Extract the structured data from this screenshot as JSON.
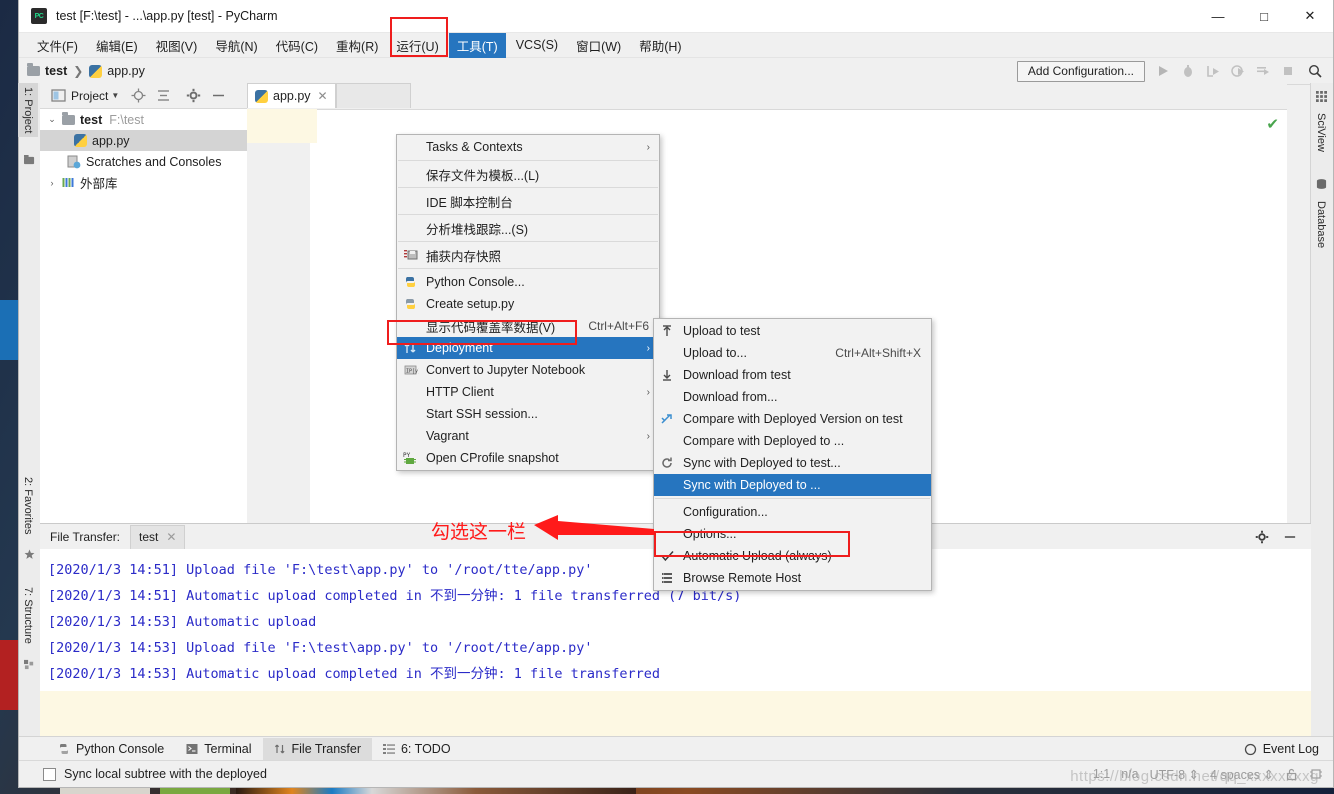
{
  "window": {
    "title": "test [F:\\test] - ...\\app.py [test] - PyCharm",
    "logo_text": "PC",
    "minimize": "—",
    "maximize": "□",
    "close": "✕"
  },
  "menubar": {
    "items": [
      {
        "label": "文件(F)",
        "active": false
      },
      {
        "label": "编辑(E)",
        "active": false
      },
      {
        "label": "视图(V)",
        "active": false
      },
      {
        "label": "导航(N)",
        "active": false
      },
      {
        "label": "代码(C)",
        "active": false
      },
      {
        "label": "重构(R)",
        "active": false
      },
      {
        "label": "运行(U)",
        "active": false
      },
      {
        "label": "工具(T)",
        "active": true
      },
      {
        "label": "VCS(S)",
        "active": false
      },
      {
        "label": "窗口(W)",
        "active": false
      },
      {
        "label": "帮助(H)",
        "active": false
      }
    ]
  },
  "navbar": {
    "crumb_project": "test",
    "crumb_sep": "❯",
    "crumb_file": "app.py",
    "add_configuration": "Add Configuration..."
  },
  "left_strip": {
    "project_label": "1: Project",
    "favorites_label": "2: Favorites",
    "structure_label": "7: Structure"
  },
  "right_strip": {
    "sciview_label": "SciView",
    "database_label": "Database"
  },
  "project_panel": {
    "header_label": "Project",
    "tree": [
      {
        "label": "test",
        "path": "F:\\test",
        "icon": "folder-icon",
        "twisty": "⌄",
        "selected": false,
        "indent": 0
      },
      {
        "label": "app.py",
        "path": "",
        "icon": "python-file-icon",
        "twisty": "",
        "selected": true,
        "indent": 1
      },
      {
        "label": "Scratches and Consoles",
        "path": "",
        "icon": "scratches-icon",
        "twisty": "",
        "selected": false,
        "indent": 1
      },
      {
        "label": "外部库",
        "path": "",
        "icon": "library-icon",
        "twisty": "›",
        "selected": false,
        "indent": 0
      }
    ]
  },
  "editor": {
    "tab_label": "app.py",
    "tab_close": "✕"
  },
  "tools_menu": {
    "items": [
      {
        "label": "Tasks & Contexts",
        "underline": "T",
        "icon": "",
        "arrow": "›",
        "accel": "",
        "check": false,
        "highlight": false,
        "sep_after": false
      },
      {
        "label": "保存文件为模板...(L)",
        "icon": "",
        "arrow": "",
        "accel": "",
        "check": false,
        "highlight": false,
        "sep_after": false
      },
      {
        "label": "IDE 脚本控制台",
        "icon": "",
        "arrow": "",
        "accel": "",
        "check": false,
        "highlight": false,
        "sep_after": false
      },
      {
        "label": "分析堆栈跟踪...(S)",
        "icon": "",
        "arrow": "",
        "accel": "",
        "check": false,
        "highlight": false,
        "sep_after": false
      },
      {
        "label": "捕获内存快照",
        "icon": "memory-snapshot-icon",
        "arrow": "",
        "accel": "",
        "check": false,
        "highlight": false,
        "sep_after": false
      },
      {
        "label": "Python Console...",
        "icon": "python-console-icon",
        "arrow": "",
        "accel": "",
        "check": false,
        "highlight": false,
        "sep_after": false
      },
      {
        "label": "Create setup.py",
        "icon": "python-setup-icon",
        "arrow": "",
        "accel": "",
        "check": false,
        "highlight": false,
        "sep_after": false
      },
      {
        "label": "显示代码覆盖率数据(V)",
        "icon": "",
        "arrow": "",
        "accel": "Ctrl+Alt+F6",
        "check": false,
        "highlight": false,
        "sep_after": false
      },
      {
        "label": "Deployment",
        "underline": "e",
        "icon": "deployment-icon",
        "arrow": "›",
        "accel": "",
        "check": false,
        "highlight": true,
        "sep_after": false
      },
      {
        "label": "Convert to Jupyter Notebook",
        "icon": "jupyter-icon",
        "arrow": "",
        "accel": "",
        "check": false,
        "highlight": false,
        "sep_after": false
      },
      {
        "label": "HTTP Client",
        "icon": "",
        "arrow": "›",
        "accel": "",
        "check": false,
        "highlight": false,
        "sep_after": false
      },
      {
        "label": "Start SSH session...",
        "icon": "",
        "arrow": "",
        "accel": "",
        "check": false,
        "highlight": false,
        "sep_after": false
      },
      {
        "label": "Vagrant",
        "icon": "",
        "arrow": "›",
        "accel": "",
        "check": false,
        "highlight": false,
        "sep_after": false
      },
      {
        "label": "Open CProfile snapshot",
        "icon": "cprofile-icon",
        "arrow": "",
        "accel": "",
        "check": false,
        "highlight": false,
        "sep_after": false
      }
    ]
  },
  "deployment_submenu": {
    "items": [
      {
        "label": "Upload to test",
        "icon": "upload-icon",
        "accel": "",
        "check": false,
        "highlight": false,
        "sep_after": false
      },
      {
        "label": "Upload to...",
        "icon": "",
        "accel": "Ctrl+Alt+Shift+X",
        "check": false,
        "highlight": false,
        "sep_after": false
      },
      {
        "label": "Download from test",
        "icon": "download-icon",
        "accel": "",
        "check": false,
        "highlight": false,
        "sep_after": false
      },
      {
        "label": "Download from...",
        "icon": "",
        "accel": "",
        "check": false,
        "highlight": false,
        "sep_after": false
      },
      {
        "label": "Compare with Deployed Version on test",
        "icon": "compare-icon",
        "accel": "",
        "check": false,
        "highlight": false,
        "sep_after": false
      },
      {
        "label": "Compare with Deployed to ...",
        "icon": "",
        "accel": "",
        "check": false,
        "highlight": false,
        "sep_after": false
      },
      {
        "label": "Sync with Deployed to test...",
        "icon": "sync-icon",
        "accel": "",
        "check": false,
        "highlight": false,
        "sep_after": false
      },
      {
        "label": "Sync with Deployed to ...",
        "icon": "",
        "accel": "",
        "check": false,
        "highlight": true,
        "sep_after": true
      },
      {
        "label": "Configuration...",
        "icon": "",
        "accel": "",
        "check": false,
        "highlight": false,
        "sep_after": false
      },
      {
        "label": "Options...",
        "icon": "",
        "accel": "",
        "check": false,
        "highlight": false,
        "sep_after": false
      },
      {
        "label": "Automatic Upload (always)",
        "icon": "",
        "accel": "",
        "check": true,
        "highlight": false,
        "sep_after": false
      },
      {
        "label": "Browse Remote Host",
        "icon": "browse-remote-icon",
        "accel": "",
        "check": false,
        "highlight": false,
        "sep_after": false
      }
    ]
  },
  "annotation": {
    "text": "勾选这一栏",
    "color": "#ff1a1a"
  },
  "file_transfer": {
    "panel_label": "File Transfer:",
    "tab_label": "test",
    "tab_close": "✕",
    "lines": [
      "[2020/1/3 14:51] Upload file 'F:\\test\\app.py' to '/root/tte/app.py'",
      "[2020/1/3 14:51] Automatic upload completed in 不到一分钟: 1 file transferred (7 bit/s)",
      "[2020/1/3 14:53] Automatic upload",
      "[2020/1/3 14:53] Upload file 'F:\\test\\app.py' to '/root/tte/app.py'",
      "[2020/1/3 14:53] Automatic upload completed in 不到一分钟: 1 file transferred"
    ]
  },
  "bottom_bar": {
    "tabs": [
      {
        "label": "Python Console",
        "icon": "python-console-icon",
        "active": false
      },
      {
        "label": "Terminal",
        "icon": "terminal-icon",
        "active": false
      },
      {
        "label": "File Transfer",
        "icon": "file-transfer-icon",
        "active": true
      },
      {
        "label": "6: TODO",
        "icon": "todo-icon",
        "active": false
      }
    ],
    "event_log": "Event Log"
  },
  "status_bar": {
    "message": "Sync local subtree with the deployed",
    "caret": "1:1",
    "line_sep": "n/a",
    "encoding": "UTF-8",
    "indent": "4 spaces",
    "watermark": "https://blog.csdn.net/qq_xxxxxxxxg"
  },
  "colors": {
    "accent": "#2675bf",
    "highlight_box": "#ef1d1d",
    "console_text": "#2b2bc8",
    "checkmark": "#49a54d"
  }
}
